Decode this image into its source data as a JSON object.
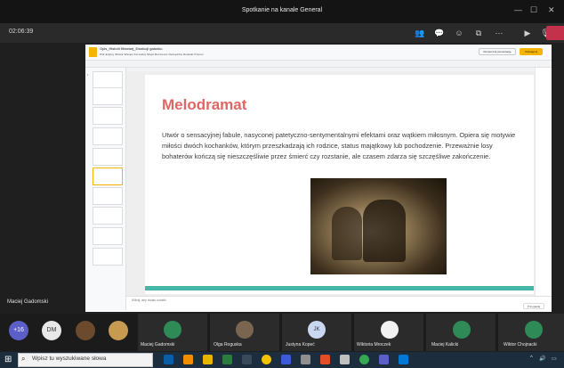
{
  "window": {
    "title": "Spotkanie na kanale General"
  },
  "meeting": {
    "timer": "02:06:39",
    "icons": [
      "people-icon",
      "chat-icon",
      "reactions-icon",
      "share-tray-icon",
      "more-icon",
      "camera-icon",
      "mic-icon",
      "leave-icon"
    ]
  },
  "slides_app": {
    "doc_title": "Opis_Historii filmowej_Ewolucji gatunku",
    "menu": "Plik  Edytuj  Widok  Wstaw  Formatuj  Slajd  Rozmieść  Narzędzia  Dodatki  Pomoc",
    "present_label": "Rozpocznij prezentację",
    "share_label": "Udostępnij",
    "notes_placeholder": "Kliknij, aby dodać notatki",
    "zoom_chip": "Przeglądaj"
  },
  "slide": {
    "title": "Melodramat",
    "body": "Utwór o sensacyjnej fabule, nasyconej patetyczno-sentymentalnymi efektami oraz wątkiem miłosnym. Opiera się motywie miłości dwóch kochanków, którym przeszkadzają ich rodzice, status majątkowy lub pochodzenie. Przeważnie losy bohaterów kończą się nieszczęśliwie przez śmierć czy rozstanie, ale czasem zdarza się szczęśliwe zakończenie."
  },
  "presenter_name": "Maciej Gadomski",
  "participants": {
    "overflow": "+16",
    "avatars": [
      {
        "initials": "DM",
        "color": "#e8e8e8"
      }
    ],
    "tiles": [
      {
        "name": "Maciej Gadomski"
      },
      {
        "name": "Olga Roguska"
      },
      {
        "name": "Justyna Kopeć",
        "initials": "JK"
      },
      {
        "name": "Wiktoria Mroczek"
      },
      {
        "name": "Maciej Kalicki"
      },
      {
        "name": "Wiktor Chojnacki"
      }
    ]
  },
  "taskbar": {
    "search_placeholder": "Wpisz tu wyszukiwane słowa"
  }
}
